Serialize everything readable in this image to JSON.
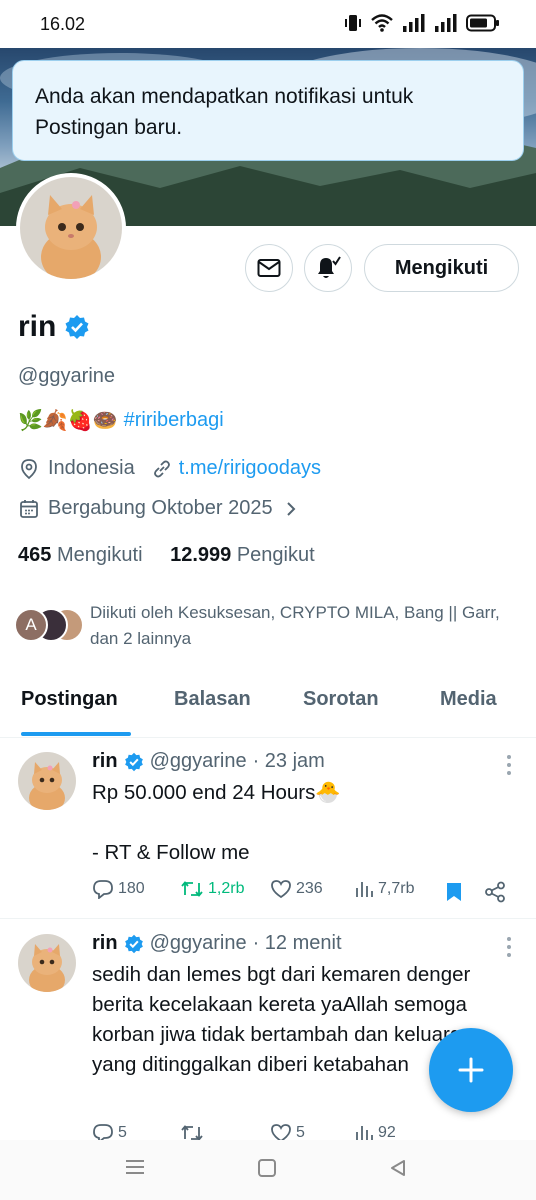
{
  "status_bar": {
    "time": "16.02",
    "icons": [
      "vibrate-icon",
      "wifi-icon",
      "signal-icon",
      "signal-icon",
      "battery-icon"
    ]
  },
  "toast": {
    "message": "Anda akan mendapatkan notifikasi untuk Postingan baru."
  },
  "profile": {
    "name": "rin",
    "handle": "@ggyarine",
    "bio_emojis": "🌿🍂🍓🍩",
    "bio_hashtag": "#ririberbagi",
    "location": "Indonesia",
    "link": "t.me/ririgoodays",
    "joined": "Bergabung Oktober 2025",
    "following_count": "465",
    "following_label": "Mengikuti",
    "followers_count": "12.999",
    "followers_label": "Pengikut",
    "followed_by": "Diikuti oleh Kesuksesan, CRYPTO MILA, Bang || Garr, dan 2 lainnya",
    "followed_avatar_letter": "A",
    "follow_button_label": "Mengikuti"
  },
  "tabs": [
    {
      "label": "Postingan",
      "active": true
    },
    {
      "label": "Balasan",
      "active": false
    },
    {
      "label": "Sorotan",
      "active": false
    },
    {
      "label": "Media",
      "active": false
    }
  ],
  "tweets": [
    {
      "name": "rin",
      "handle": "@ggyarine",
      "time": "· 23 jam",
      "text": "Rp 50.000 end 24 Hours🐣\n\n- RT & Follow me",
      "replies": "180",
      "retweets": "1,2rb",
      "likes": "236",
      "views": "7,7rb"
    },
    {
      "name": "rin",
      "handle": "@ggyarine",
      "time": "· 12 menit",
      "text": "sedih dan lemes bgt dari kemaren denger berita kecelakaan kereta yaAllah semoga korban jiwa tidak bertambah dan keluarga yang ditinggalkan diberi ketabahan",
      "replies": "5",
      "retweets": "",
      "likes": "5",
      "views": "92"
    }
  ],
  "colors": {
    "accent": "#1d9bf0",
    "retweet_green": "#00ba7c",
    "muted": "#536471",
    "toast_bg": "#e8f5fd"
  }
}
